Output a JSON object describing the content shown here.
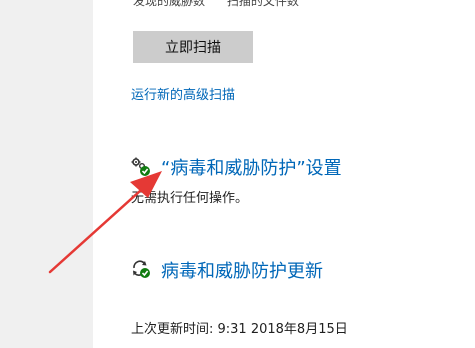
{
  "scan": {
    "threats_label": "发现的威胁数",
    "files_label": "扫描的文件数",
    "scan_now_button": "立即扫描",
    "advanced_scan_link": "运行新的高级扫描"
  },
  "settings_section": {
    "title": "“病毒和威胁防护”设置",
    "description": "无需执行任何操作。",
    "icon": "gear-check-icon"
  },
  "updates_section": {
    "title": "病毒和威胁防护更新",
    "last_update": "上次更新时间: 9:31 2018年8月15日",
    "icon": "refresh-check-icon"
  },
  "annotation": {
    "arrow_color": "#e53935"
  },
  "colors": {
    "link": "#0067b8",
    "button": "#cccccc",
    "status_ok": "#107c10"
  }
}
